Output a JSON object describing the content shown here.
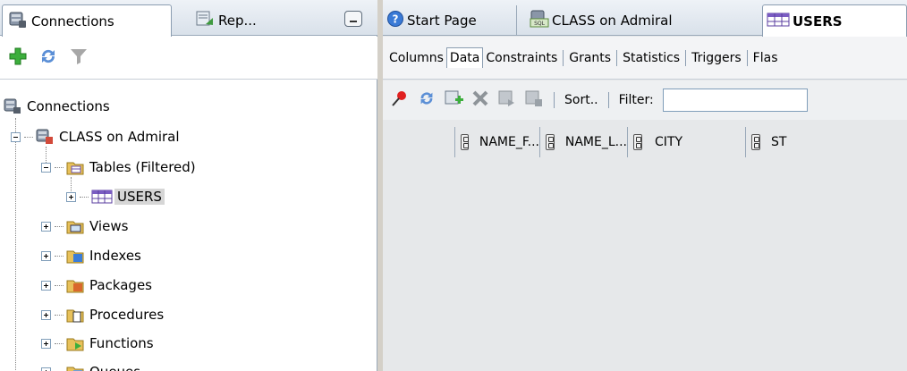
{
  "left_panel": {
    "tabs": [
      {
        "label": "Connections",
        "active": true
      },
      {
        "label": "Rep...",
        "active": false
      }
    ],
    "toolbar": {
      "icons": [
        "add-icon",
        "refresh-icon",
        "filter-icon"
      ]
    },
    "tree": {
      "root": "Connections",
      "connection": "CLASS on Admiral",
      "tables_node": "Tables (Filtered)",
      "table_item": "USERS",
      "nodes": [
        "Views",
        "Indexes",
        "Packages",
        "Procedures",
        "Functions",
        "Queues"
      ]
    }
  },
  "right_panel": {
    "tabs": [
      {
        "label": "Start Page",
        "icon": "help-icon"
      },
      {
        "label": "CLASS on Admiral",
        "icon": "sql-worksheet-icon"
      },
      {
        "label": "USERS",
        "icon": "table-icon",
        "active": true
      }
    ],
    "subtabs": [
      "Columns",
      "Data",
      "Constraints",
      "Grants",
      "Statistics",
      "Triggers",
      "Flas"
    ],
    "active_subtab": "Data",
    "toolbar": {
      "sort_label": "Sort..",
      "filter_label": "Filter:",
      "filter_value": ""
    },
    "grid": {
      "columns": [
        "NAME_F...",
        "NAME_L...",
        "CITY",
        "ST"
      ]
    }
  },
  "colors": {
    "accent_tab_border": "#8b9db1",
    "tree_selected_bg": "#d6d6d6",
    "grid_bg": "#e6e8ea"
  }
}
